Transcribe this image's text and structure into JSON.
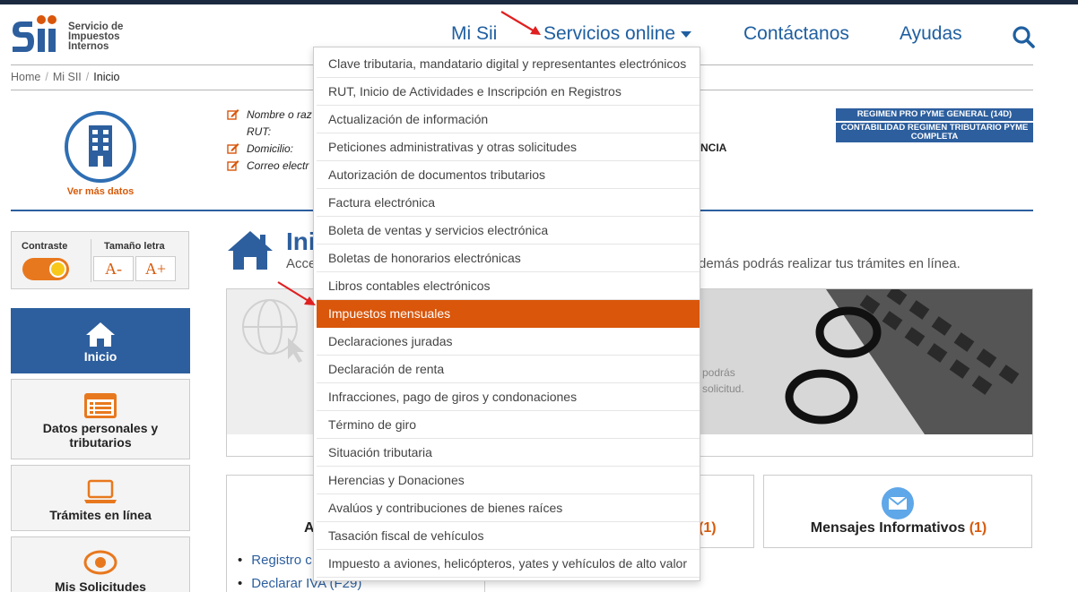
{
  "logo": {
    "lines": [
      "Servicio de",
      "Impuestos",
      "Internos"
    ]
  },
  "nav": {
    "mi_sii": "Mi Sii",
    "servicios": "Servicios online",
    "contactanos": "Contáctanos",
    "ayudas": "Ayudas"
  },
  "breadcrumb": {
    "home": "Home",
    "mi_sii": "Mi SII",
    "current": "Inicio"
  },
  "profile": {
    "ver_mas": "Ver más datos",
    "nombre": "Nombre o raz",
    "rut": "RUT:",
    "domicilio": "Domicilio:",
    "correo": "Correo electr",
    "partial_right": "NCIA"
  },
  "tags": {
    "regimen": "REGIMEN PRO PYME GENERAL (14D)",
    "contabilidad": "CONTABILIDAD REGIMEN TRIBUTARIO PYME COMPLETA"
  },
  "accessibility": {
    "contrast_label": "Contraste",
    "font_size_label": "Tamaño letra",
    "decrease": "A-",
    "increase": "A+"
  },
  "sidebar": {
    "items": [
      {
        "label": "Inicio"
      },
      {
        "label": "Datos personales y tributarios"
      },
      {
        "label": "Trámites en línea"
      },
      {
        "label": "Mis Solicitudes"
      }
    ]
  },
  "main": {
    "title_partial": "Ini",
    "subtitle_left": "Acce",
    "subtitle_right": "demás podrás realizar tus trámites en línea.",
    "banner_ghost_1": "podrás",
    "banner_ghost_2": "solicitud."
  },
  "cards": {
    "c1_letter": "A",
    "c1_links": [
      "Registro c",
      "Declarar IVA (F29)"
    ],
    "c2_count": "(1)",
    "c3_title": "Mensajes Informativos",
    "c3_count": "(1)"
  },
  "dropdown": {
    "items": [
      "Clave tributaria, mandatario digital y representantes electrónicos",
      "RUT, Inicio de Actividades e Inscripción en Registros",
      "Actualización de información",
      "Peticiones administrativas y otras solicitudes",
      "Autorización de documentos tributarios",
      "Factura electrónica",
      "Boleta de ventas y servicios electrónica",
      "Boletas de honorarios electrónicas",
      "Libros contables electrónicos",
      "Impuestos mensuales",
      "Declaraciones juradas",
      "Declaración de renta",
      "Infracciones, pago de giros y condonaciones",
      "Término de giro",
      "Situación tributaria",
      "Herencias y Donaciones",
      "Avalúos y contribuciones de bienes raíces",
      "Tasación fiscal de vehículos",
      "Impuesto a aviones, helicópteros, yates y vehículos de alto valor"
    ],
    "highlighted_index": 9
  },
  "colors": {
    "brand_blue": "#2d5f9e",
    "nav_blue": "#1f5fa0",
    "accent_orange": "#d9560b",
    "arrow_red": "#e02020"
  }
}
